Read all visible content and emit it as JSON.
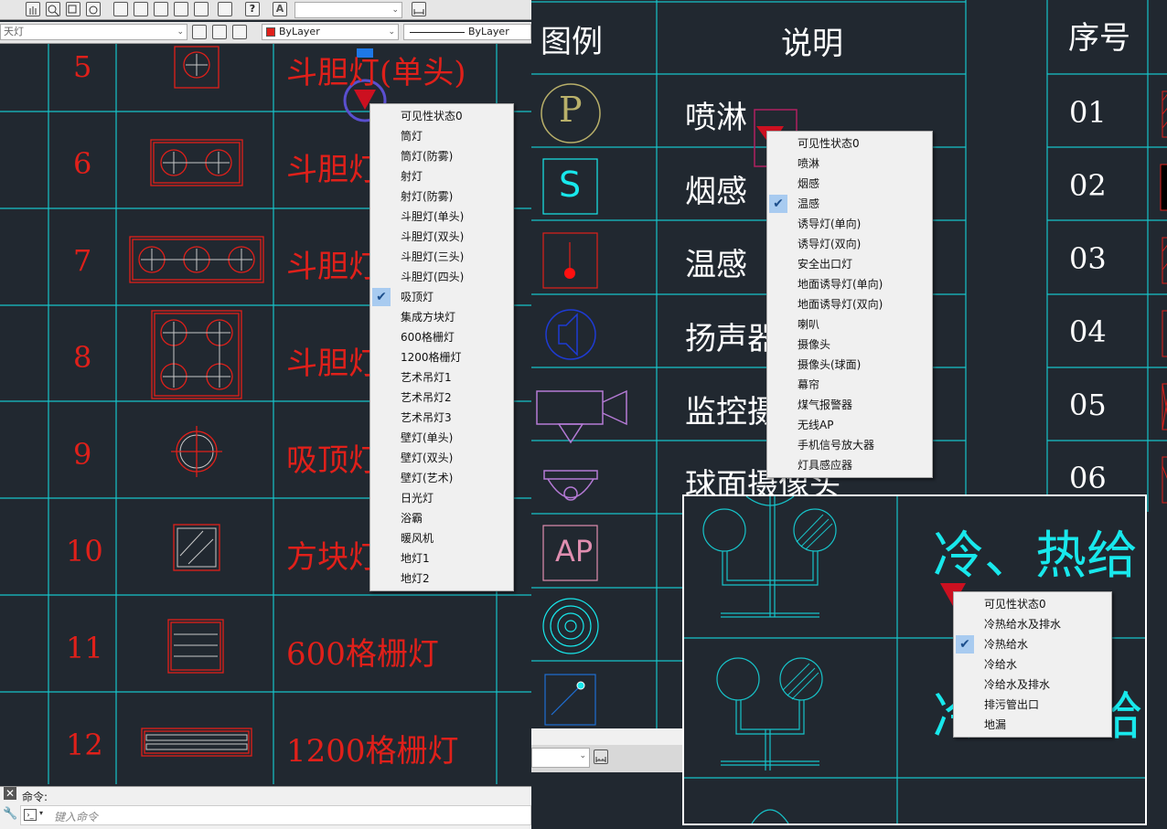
{
  "toolbar": {
    "layer_value": "天灯",
    "color_value": "ByLayer",
    "linetype_value": "ByLayer"
  },
  "left_table": {
    "rows": [
      {
        "no": "5",
        "desc": "斗胆灯(单头)"
      },
      {
        "no": "6",
        "desc": "斗胆灯"
      },
      {
        "no": "7",
        "desc": "斗胆灯"
      },
      {
        "no": "8",
        "desc": "斗胆灯"
      },
      {
        "no": "9",
        "desc": "吸顶灯"
      },
      {
        "no": "10",
        "desc": "方块灯"
      },
      {
        "no": "11",
        "desc": "600格栅灯"
      },
      {
        "no": "12",
        "desc": "1200格栅灯"
      }
    ]
  },
  "menu1": {
    "items": [
      "可见性状态0",
      "筒灯",
      "筒灯(防雾)",
      "射灯",
      "射灯(防雾)",
      "斗胆灯(单头)",
      "斗胆灯(双头)",
      "斗胆灯(三头)",
      "斗胆灯(四头)",
      "吸顶灯",
      "集成方块灯",
      "600格栅灯",
      "1200格栅灯",
      "艺术吊灯1",
      "艺术吊灯2",
      "艺术吊灯3",
      "壁灯(单头)",
      "壁灯(双头)",
      "壁灯(艺术)",
      "日光灯",
      "浴霸",
      "暖风机",
      "地灯1",
      "地灯2"
    ],
    "checked_index": 9
  },
  "mid_table": {
    "header_legend": "图例",
    "header_desc": "说明",
    "rows": [
      {
        "icon": "P",
        "desc": "喷淋"
      },
      {
        "icon": "S",
        "desc": "烟感"
      },
      {
        "icon": "",
        "desc": "温感"
      },
      {
        "icon": "",
        "desc": "扬声器"
      },
      {
        "icon": "",
        "desc": "监控摄"
      },
      {
        "icon": "",
        "desc": "球面摄像头"
      },
      {
        "icon": "AP",
        "desc": ""
      },
      {
        "icon": "",
        "desc": ""
      },
      {
        "icon": "",
        "desc": ""
      }
    ]
  },
  "menu2": {
    "items": [
      "可见性状态0",
      "喷淋",
      "烟感",
      "温感",
      "诱导灯(单向)",
      "诱导灯(双向)",
      "安全出口灯",
      "地面诱导灯(单向)",
      "地面诱导灯(双向)",
      "喇叭",
      "摄像头",
      "摄像头(球面)",
      "幕帘",
      "煤气报警器",
      "无线AP",
      "手机信号放大器",
      "灯具感应器"
    ],
    "checked_index": 3
  },
  "right_table": {
    "header": "序号",
    "rows": [
      "01",
      "02",
      "03",
      "04",
      "05",
      "06"
    ]
  },
  "plumbing_panel": {
    "row1_text": "冷、热给",
    "row2_text": "冷",
    "row2_text_b": "给"
  },
  "menu3": {
    "items": [
      "可见性状态0",
      "冷热给水及排水",
      "冷热给水",
      "冷给水",
      "冷给水及排水",
      "排污管出口",
      "地漏"
    ],
    "checked_index": 2
  },
  "command": {
    "label": "命令:",
    "placeholder": "键入命令"
  },
  "colors": {
    "background": "#212830",
    "grid": "#17c3c9",
    "red_text": "#e0201a",
    "cyan_text": "#18e8ec",
    "checked": "#a8cbf0"
  }
}
